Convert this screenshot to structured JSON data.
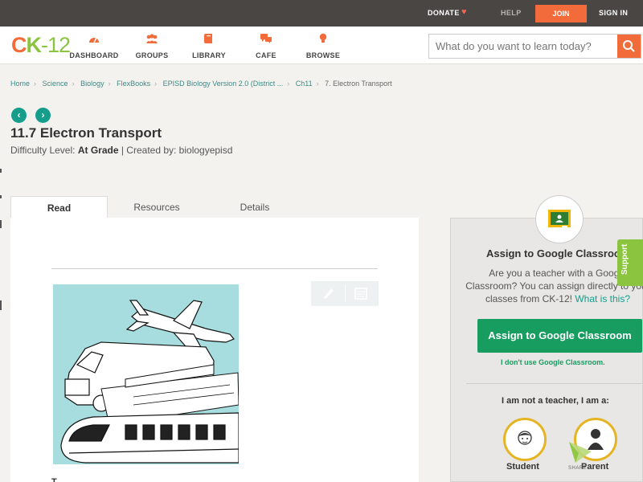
{
  "topbar": {
    "donate": "DONATE",
    "help": "HELP",
    "join": "JOIN",
    "signin": "SIGN IN"
  },
  "logo": {
    "c": "C",
    "k": "K",
    "n": "-12"
  },
  "nav": [
    {
      "label": "DASHBOARD",
      "icon": "dashboard-gauge-icon"
    },
    {
      "label": "GROUPS",
      "icon": "groups-people-icon"
    },
    {
      "label": "LIBRARY",
      "icon": "library-book-icon"
    },
    {
      "label": "CAFE",
      "icon": "cafe-chat-icon"
    },
    {
      "label": "BROWSE",
      "icon": "browse-lightbulb-icon"
    }
  ],
  "search": {
    "placeholder": "What do you want to learn today?"
  },
  "breadcrumb": [
    "Home",
    "Science",
    "Biology",
    "FlexBooks",
    "EPISD Biology Version 2.0 (District ...",
    "Ch11",
    "7. Electron Transport"
  ],
  "title": "11.7 Electron Transport",
  "meta": {
    "difficulty_label": "Difficulty Level:",
    "difficulty_value": "At Grade",
    "created_by": "| Created by: biologyepisd"
  },
  "tabs": [
    "Read",
    "Resources",
    "Details"
  ],
  "content": {
    "caption": "T"
  },
  "classroom": {
    "title": "Assign to Google Classroom",
    "desc": "Are you a teacher with a Google Classroom? You can assign directly to your classes from CK-12!",
    "desc_link": "What is this?",
    "button": "Assign to Google Classroom",
    "no_link": "I don't use Google Classroom.",
    "role_prompt": "I am not a teacher, I am a:",
    "roles": [
      "Student",
      "Parent"
    ]
  },
  "support": "Support",
  "share": "SHARE",
  "colors": {
    "brand_orange": "#f26b3a",
    "brand_green": "#8bc53f",
    "teal": "#179d8b",
    "classroom_green": "#179d60",
    "role_ring": "#e5b423"
  }
}
